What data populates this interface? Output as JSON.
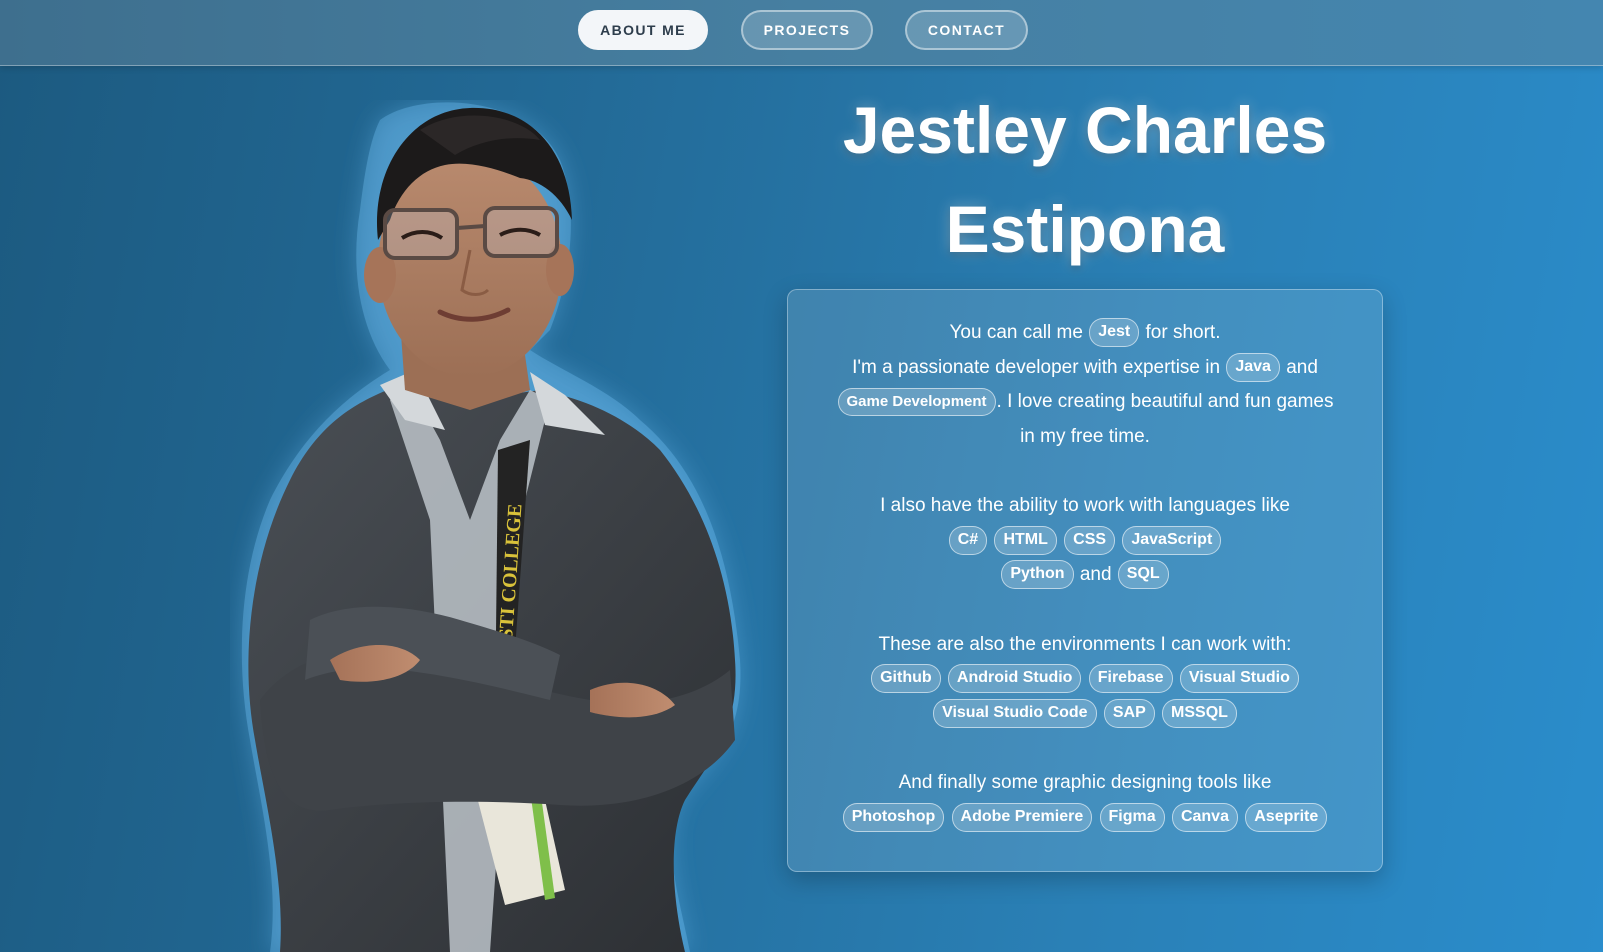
{
  "nav": {
    "about": "ABOUT ME",
    "projects": "PROJECTS",
    "contact": "CONTACT"
  },
  "hero": {
    "name_line1": "Jestley Charles",
    "name_line2": "Estipona",
    "portrait_lanyard_text": "STI COLLEGE"
  },
  "bio": {
    "intro_prefix": "You can call me",
    "nickname": "Jest",
    "intro_suffix": "for short.",
    "expertise_prefix": "I'm a passionate developer with expertise in",
    "expertise_lang": "Java",
    "and_1": "and",
    "expertise_field": "Game Development",
    "expertise_suffix": ". I love creating beautiful and fun games in my free time.",
    "languages_intro": "I also have the ability to work with languages like",
    "languages_row1": [
      "C#",
      "HTML",
      "CSS",
      "JavaScript"
    ],
    "languages_row2_a": "Python",
    "and_2": "and",
    "languages_row2_b": "SQL",
    "environments_intro": "These are also the environments I can work with:",
    "environments_row1": [
      "Github",
      "Android Studio",
      "Firebase",
      "Visual Studio"
    ],
    "environments_row2": [
      "Visual Studio Code",
      "SAP",
      "MSSQL"
    ],
    "design_intro": "And finally some graphic designing tools like",
    "design_tools": [
      "Photoshop",
      "Adobe Premiere",
      "Figma",
      "Canva",
      "Aseprite"
    ]
  },
  "colors": {
    "background_start": "#1c5a80",
    "background_end": "#2a8dcc",
    "navbar": "#467fa1",
    "active_tab_bg": "#f3f6f9",
    "active_tab_text": "#2d3d4c"
  }
}
